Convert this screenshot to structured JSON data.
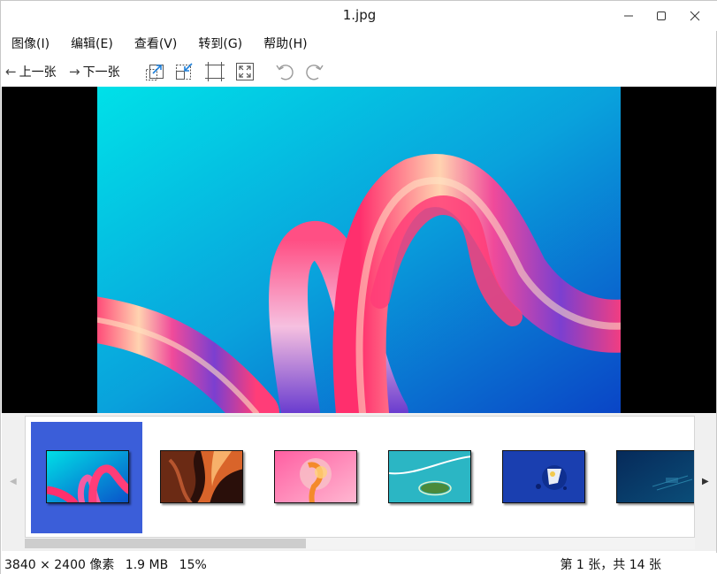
{
  "window": {
    "title": "1.jpg"
  },
  "menu": [
    "图像(I)",
    "编辑(E)",
    "查看(V)",
    "转到(G)",
    "帮助(H)"
  ],
  "toolbar": {
    "prev_label": "上一张",
    "next_label": "下一张",
    "icons": [
      "zoom-in-icon",
      "zoom-out-icon",
      "fit-window-icon",
      "full-screen-icon",
      "rotate-left-icon",
      "rotate-right-icon"
    ]
  },
  "image": {
    "background_colors": [
      "#00dfe6",
      "#0a8fd6",
      "#0a4fc9"
    ],
    "ribbon_colors": [
      "#ff2f6d",
      "#f35ca3",
      "#7b3fd0",
      "#ffd9a0"
    ]
  },
  "filmstrip": {
    "selected_index": 0,
    "thumbnails": [
      "cyan-ribbon-wallpaper",
      "canyon-wallpaper",
      "pink-abstract-wallpaper",
      "island-aerial-wallpaper",
      "blue-illustration-wallpaper",
      "dark-blue-wallpaper"
    ],
    "scroll_fraction": 0.42
  },
  "status": {
    "dimensions": "3840 × 2400 像素",
    "file_size": "1.9 MB",
    "zoom": "15%",
    "position": "第 1 张，共 14 张"
  },
  "colors": {
    "selection": "#3b5ed9"
  }
}
